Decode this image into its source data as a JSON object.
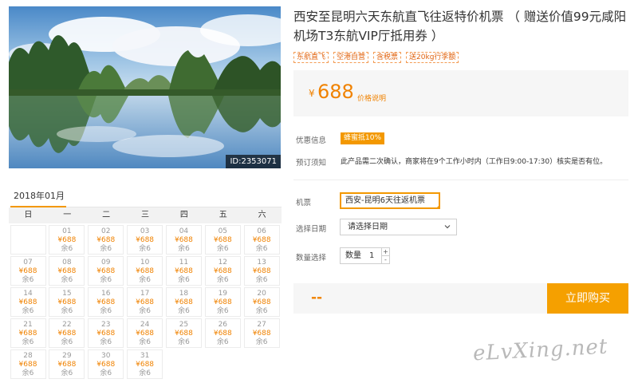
{
  "hero": {
    "image_id": "ID:2353071"
  },
  "product": {
    "title": "西安至昆明六天东航直飞往返特价机票 （ 赠送价值99元咸阳机场T3东航VIP厅抵用券 ）",
    "tags": [
      "东航直飞",
      "空港自营",
      "含税票",
      "送20kg行李额"
    ],
    "price_currency": "¥",
    "price_value": "688",
    "price_note": "价格说明"
  },
  "info": {
    "promo_label": "优惠信息",
    "promo_badge": "蜂蜜抵10%",
    "notice_label": "预订须知",
    "notice_text": "此产品需二次确认，商家将在9个工作小时内（工作日9:00-17:30）核实是否有位。"
  },
  "form": {
    "ticket_label": "机票",
    "ticket_value": "西安-昆明6天往返机票",
    "date_label": "选择日期",
    "date_placeholder": "请选择日期",
    "qty_label": "数量选择",
    "qty_inner_label": "数量",
    "qty_value": "1",
    "plus": "+",
    "minus": "-"
  },
  "buy": {
    "total": "--",
    "button_label": "立即购买"
  },
  "calendar": {
    "month": "2018年01月",
    "weekdays": [
      "日",
      "一",
      "二",
      "三",
      "四",
      "五",
      "六"
    ],
    "days": [
      {
        "d": "01",
        "p": "¥688",
        "s": "余6"
      },
      {
        "d": "02",
        "p": "¥688",
        "s": "余6"
      },
      {
        "d": "03",
        "p": "¥688",
        "s": "余6"
      },
      {
        "d": "04",
        "p": "¥688",
        "s": "余6"
      },
      {
        "d": "05",
        "p": "¥688",
        "s": "余6"
      },
      {
        "d": "06",
        "p": "¥688",
        "s": "余6"
      },
      {
        "d": "07",
        "p": "¥688",
        "s": "余6"
      },
      {
        "d": "08",
        "p": "¥688",
        "s": "余6"
      },
      {
        "d": "09",
        "p": "¥688",
        "s": "余6"
      },
      {
        "d": "10",
        "p": "¥688",
        "s": "余6"
      },
      {
        "d": "11",
        "p": "¥688",
        "s": "余6"
      },
      {
        "d": "12",
        "p": "¥688",
        "s": "余6"
      },
      {
        "d": "13",
        "p": "¥688",
        "s": "余6"
      },
      {
        "d": "14",
        "p": "¥688",
        "s": "余6"
      },
      {
        "d": "15",
        "p": "¥688",
        "s": "余6"
      },
      {
        "d": "16",
        "p": "¥688",
        "s": "余6"
      },
      {
        "d": "17",
        "p": "¥688",
        "s": "余6"
      },
      {
        "d": "18",
        "p": "¥688",
        "s": "余6"
      },
      {
        "d": "19",
        "p": "¥688",
        "s": "余6"
      },
      {
        "d": "20",
        "p": "¥688",
        "s": "余6"
      },
      {
        "d": "21",
        "p": "¥688",
        "s": "余6"
      },
      {
        "d": "22",
        "p": "¥688",
        "s": "余6"
      },
      {
        "d": "23",
        "p": "¥688",
        "s": "余6"
      },
      {
        "d": "24",
        "p": "¥688",
        "s": "余6"
      },
      {
        "d": "25",
        "p": "¥688",
        "s": "余6"
      },
      {
        "d": "26",
        "p": "¥688",
        "s": "余6"
      },
      {
        "d": "27",
        "p": "¥688",
        "s": "余6"
      },
      {
        "d": "28",
        "p": "¥688",
        "s": "余6"
      },
      {
        "d": "29",
        "p": "¥688",
        "s": "余6"
      },
      {
        "d": "30",
        "p": "¥688",
        "s": "余6"
      },
      {
        "d": "31",
        "p": "¥688",
        "s": "余6"
      }
    ]
  },
  "watermark": "eLvXing.net",
  "colors": {
    "accent": "#f39800",
    "price": "#f08200",
    "buy_button": "#f5a000"
  }
}
